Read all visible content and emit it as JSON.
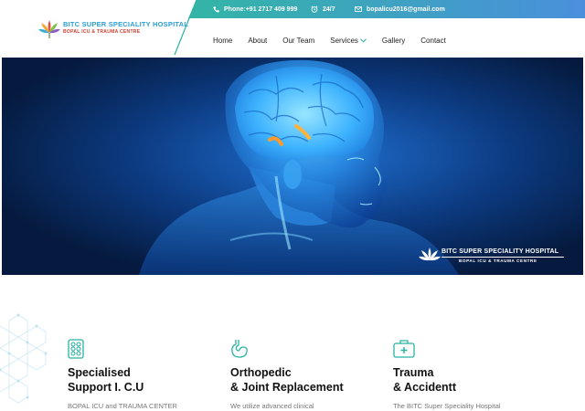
{
  "topbar": {
    "phone": "Phone:+91 2717 409 999",
    "hours": "24/7",
    "email": "bopalicu2016@gmail.com"
  },
  "logo": {
    "line1": "BITC SUPER SPECIALITY HOSPITAL",
    "line2": "BOPAL ICU & TRAUMA CENTRE"
  },
  "nav": {
    "items": [
      {
        "label": "Home"
      },
      {
        "label": "About"
      },
      {
        "label": "Our Team"
      },
      {
        "label": "Services"
      },
      {
        "label": "Gallery"
      },
      {
        "label": "Contact"
      }
    ]
  },
  "hero": {
    "logo_line1": "BITC SUPER SPECIALITY HOSPITAL",
    "logo_line2": "BOPAL ICU & TRAUMA CENTRE"
  },
  "services": {
    "cards": [
      {
        "title_line1": "Specialised",
        "title_line2": "Support I. C.U",
        "text": "BOPAL ICU and TRAUMA CENTER",
        "icon": "pills-icon"
      },
      {
        "title_line1": "Orthopedic",
        "title_line2": "& Joint Replacement",
        "text": "We utilize advanced clinical",
        "icon": "stomach-icon"
      },
      {
        "title_line1": "Trauma",
        "title_line2": "& Accidentt",
        "text": "The BITC Super Speciality Hospital",
        "icon": "first-aid-kit-icon"
      }
    ]
  },
  "colors": {
    "accent_teal": "#2ab3a3",
    "topbar_blue": "#4a90d9",
    "hero_dark": "#062148",
    "brain_glow": "#4fc3ff"
  }
}
